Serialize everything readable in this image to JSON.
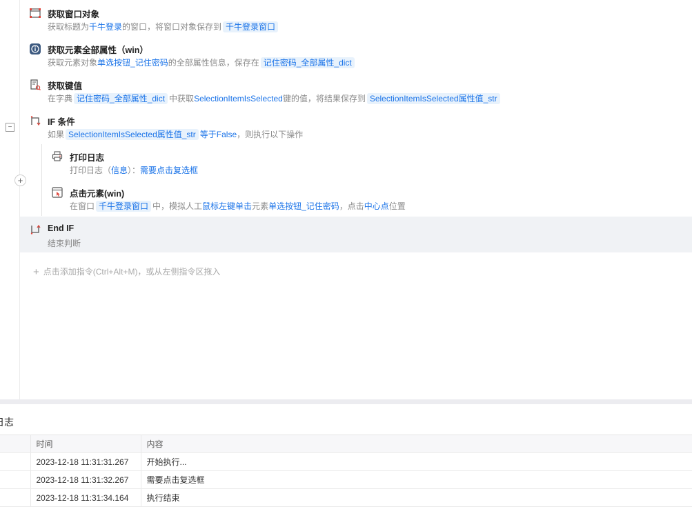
{
  "steps": [
    {
      "title": "获取窗口对象",
      "icon": "window-frame-icon",
      "desc": [
        {
          "t": "获取标题为"
        },
        {
          "t": "千牛登录",
          "kw": true
        },
        {
          "t": "的窗口，将窗口对象保存到"
        },
        {
          "t": "千牛登录窗口",
          "chip": true
        }
      ]
    },
    {
      "title": "获取元素全部属性（win）",
      "icon": "info-circle-icon",
      "desc": [
        {
          "t": "获取元素对象"
        },
        {
          "t": "单选按钮_记住密码",
          "kw": true
        },
        {
          "t": "的全部属性信息，保存在"
        },
        {
          "t": "记住密码_全部属性_dict",
          "chip": true
        }
      ]
    },
    {
      "title": "获取键值",
      "icon": "dictionary-key-icon",
      "desc": [
        {
          "t": "在字典"
        },
        {
          "t": "记住密码_全部属性_dict",
          "chip": true
        },
        {
          "t": "中获取"
        },
        {
          "t": "SelectionItemIsSelected",
          "kw": true
        },
        {
          "t": "键的值，将结果保存到"
        },
        {
          "t": "SelectionItemIsSelected属性值_str",
          "chip": true
        }
      ]
    },
    {
      "title": "IF 条件",
      "icon": "if-branch-icon",
      "desc": [
        {
          "t": "如果"
        },
        {
          "t": "SelectionItemIsSelected属性值_str",
          "chip": true
        },
        {
          "t": "等于",
          "kw": true
        },
        {
          "t": "False",
          "kw": true
        },
        {
          "t": "，则执行以下操作"
        }
      ]
    },
    {
      "title": "打印日志",
      "icon": "printer-icon",
      "desc": [
        {
          "t": "打印日志（"
        },
        {
          "t": "信息",
          "kw": true
        },
        {
          "t": "）："
        },
        {
          "t": "需要点击复选框",
          "kw": true
        }
      ]
    },
    {
      "title": "点击元素(win)",
      "icon": "click-element-icon",
      "desc": [
        {
          "t": "在窗口"
        },
        {
          "t": "千牛登录窗口",
          "chip": true
        },
        {
          "t": "中，模拟人工"
        },
        {
          "t": "鼠标左键单击",
          "kw": true
        },
        {
          "t": "元素"
        },
        {
          "t": "单选按钮_记住密码",
          "kw": true
        },
        {
          "t": "，点击"
        },
        {
          "t": "中心点",
          "kw": true
        },
        {
          "t": "位置"
        }
      ]
    },
    {
      "title": "End IF",
      "icon": "end-if-icon",
      "desc": [
        {
          "t": "结束判断"
        }
      ]
    }
  ],
  "add_hint": "点击添加指令(Ctrl+Alt+M)，或从左侧指令区拖入",
  "log": {
    "title": "日志",
    "columns": [
      "",
      "时间",
      "内容"
    ],
    "rows": [
      {
        "time": "2023-12-18 11:31:31.267",
        "content": "开始执行..."
      },
      {
        "time": "2023-12-18 11:31:32.267",
        "content": "需要点击复选框"
      },
      {
        "time": "2023-12-18 11:31:34.164",
        "content": "执行结束"
      }
    ]
  },
  "colors": {
    "accent": "#1a73e8",
    "chip_bg": "#e8f2fc",
    "selected_row": "#f0f2f5"
  }
}
